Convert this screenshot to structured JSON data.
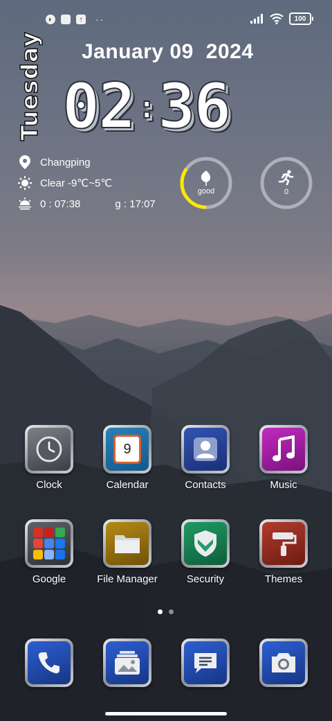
{
  "status_bar": {
    "left_icons": [
      "notification-badge-icon",
      "square-app-icon",
      "upload-app-icon"
    ],
    "more_dots": "··",
    "battery": "100"
  },
  "clock_widget": {
    "weekday": "Tuesday",
    "date": "January 09",
    "year": "2024",
    "hours": "02",
    "minutes": "36",
    "location": "Changping",
    "weather": "Clear  -9℃~5℃",
    "sunrise": "0 : 07:38",
    "sunset": "g : 17:07"
  },
  "rings": {
    "air": {
      "label": "good",
      "progress": 0.35,
      "color": "#ffe600"
    },
    "steps": {
      "label": "0",
      "progress": 0
    }
  },
  "apps": {
    "row1": [
      {
        "name": "Clock",
        "icon": "clock-icon"
      },
      {
        "name": "Calendar",
        "icon": "calendar-icon",
        "day": "9"
      },
      {
        "name": "Contacts",
        "icon": "contacts-icon"
      },
      {
        "name": "Music",
        "icon": "music-icon"
      }
    ],
    "row2": [
      {
        "name": "Google",
        "icon": "google-folder-icon"
      },
      {
        "name": "File Manager",
        "icon": "folder-icon"
      },
      {
        "name": "Security",
        "icon": "shield-icon"
      },
      {
        "name": "Themes",
        "icon": "paint-roller-icon"
      }
    ]
  },
  "dock": [
    {
      "icon": "phone-icon"
    },
    {
      "icon": "gallery-icon"
    },
    {
      "icon": "messages-icon"
    },
    {
      "icon": "camera-icon"
    }
  ],
  "pager": {
    "pages": 2,
    "current": 1
  }
}
